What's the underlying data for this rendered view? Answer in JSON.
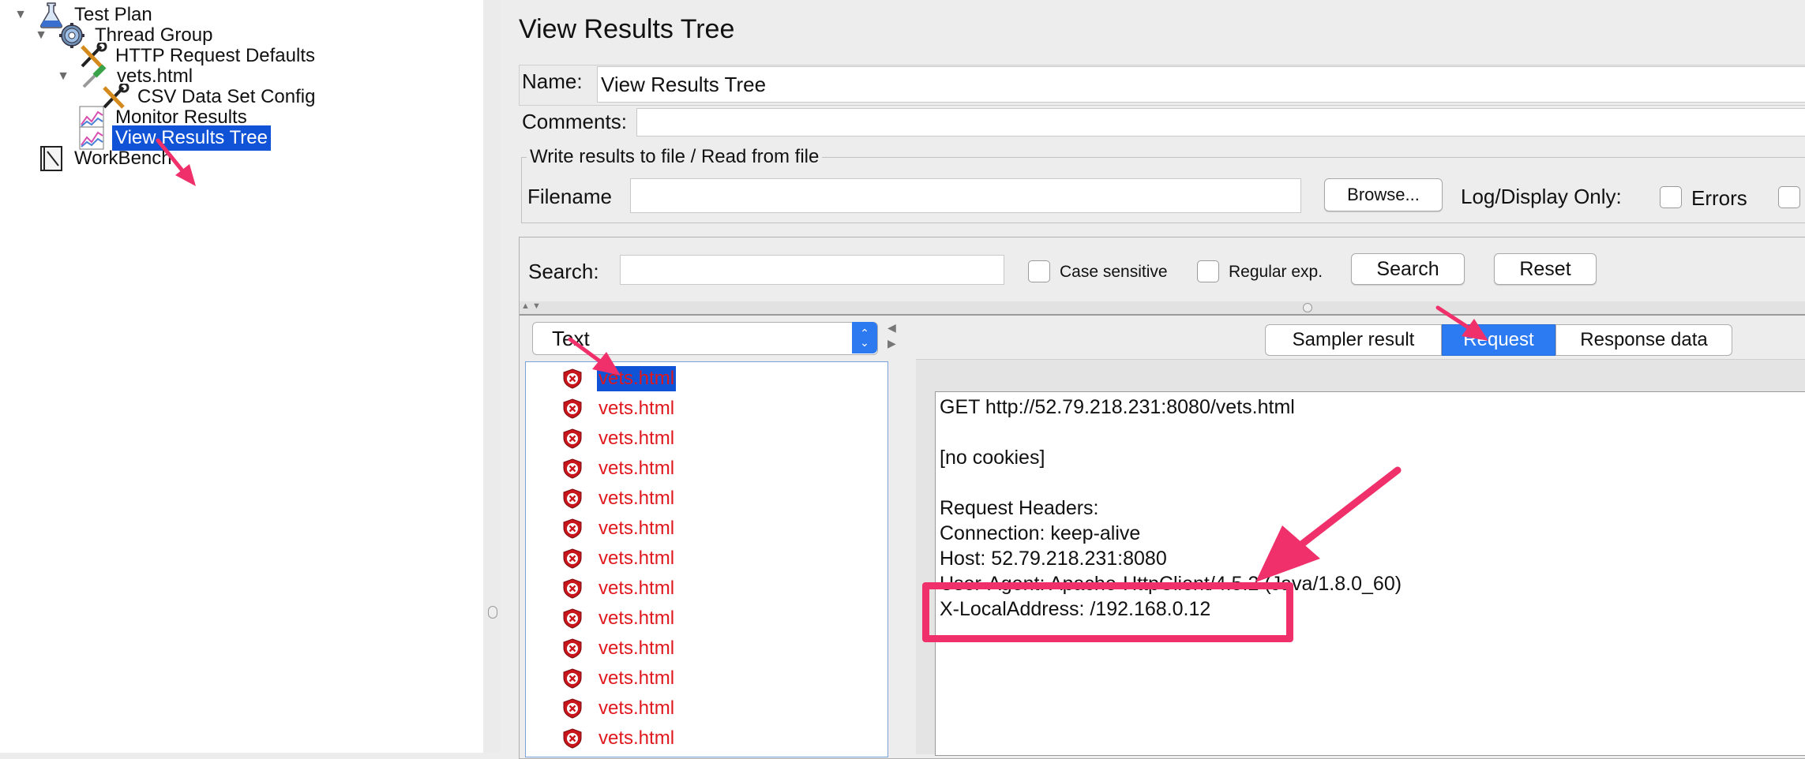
{
  "tree": {
    "items": [
      {
        "label": "Test Plan",
        "icon": "flask-icon",
        "expanded": true
      },
      {
        "label": "Thread Group",
        "icon": "gear-icon",
        "expanded": true
      },
      {
        "label": "HTTP Request Defaults",
        "icon": "tools-icon"
      },
      {
        "label": "vets.html",
        "icon": "pipette-icon",
        "expanded": true
      },
      {
        "label": "CSV Data Set Config",
        "icon": "tools-icon"
      },
      {
        "label": "Monitor Results",
        "icon": "graph-icon"
      },
      {
        "label": "View Results Tree",
        "icon": "graph-icon",
        "selected": true
      },
      {
        "label": "WorkBench",
        "icon": "notebook-icon"
      }
    ]
  },
  "panel": {
    "title": "View Results Tree",
    "name_label": "Name:",
    "name_value": "View Results Tree",
    "comments_label": "Comments:",
    "file_group_title": "Write results to file / Read from file",
    "filename_label": "Filename",
    "filename_value": "",
    "browse_label": "Browse...",
    "log_display_label": "Log/Display Only:",
    "errors_label": "Errors"
  },
  "search": {
    "label": "Search:",
    "value": "",
    "case_sensitive_label": "Case sensitive",
    "regex_label": "Regular exp.",
    "search_button": "Search",
    "reset_button": "Reset"
  },
  "renderer": {
    "selected": "Text"
  },
  "samples": [
    "vets.html",
    "vets.html",
    "vets.html",
    "vets.html",
    "vets.html",
    "vets.html",
    "vets.html",
    "vets.html",
    "vets.html",
    "vets.html",
    "vets.html",
    "vets.html",
    "vets.html"
  ],
  "tabs": [
    {
      "label": "Sampler result",
      "active": false
    },
    {
      "label": "Request",
      "active": true
    },
    {
      "label": "Response data",
      "active": false
    }
  ],
  "request": {
    "lines": [
      "GET http://52.79.218.231:8080/vets.html",
      "[no cookies]",
      "Request Headers:",
      "Connection: keep-alive",
      "Host: 52.79.218.231:8080",
      "User-Agent: Apache-HttpClient/4.5.2 (Java/1.8.0_60)",
      "X-LocalAddress: /192.168.0.12"
    ]
  },
  "colors": {
    "selection": "#1153d6",
    "error_text": "#e0171d",
    "annotation": "#f0306a",
    "tab_active": "#2c7bf3"
  }
}
